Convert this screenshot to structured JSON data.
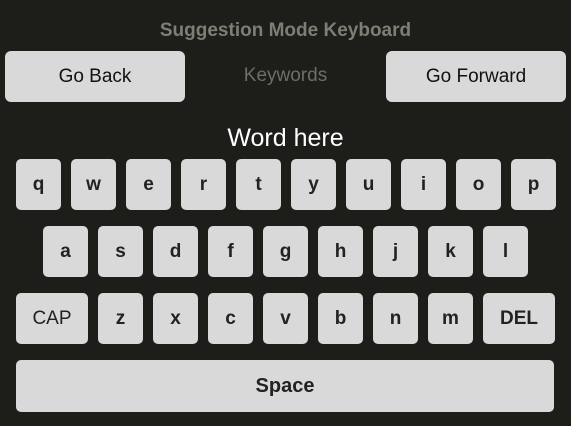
{
  "header": {
    "title": "Suggestion Mode Keyboard"
  },
  "nav": {
    "back_label": "Go Back",
    "center_label": "Keywords",
    "forward_label": "Go Forward"
  },
  "word_display": "Word here",
  "keyboard": {
    "row1": [
      "q",
      "w",
      "e",
      "r",
      "t",
      "y",
      "u",
      "i",
      "o",
      "p"
    ],
    "row2": [
      "a",
      "s",
      "d",
      "f",
      "g",
      "h",
      "j",
      "k",
      "l"
    ],
    "row3": [
      "CAP",
      "z",
      "x",
      "c",
      "v",
      "b",
      "n",
      "m",
      "DEL"
    ],
    "space_label": "Space"
  },
  "colors": {
    "background": "#1d1d19",
    "key_fill": "#d8d9d8",
    "title_text": "#7e7e75",
    "word_text": "#ffffff"
  }
}
